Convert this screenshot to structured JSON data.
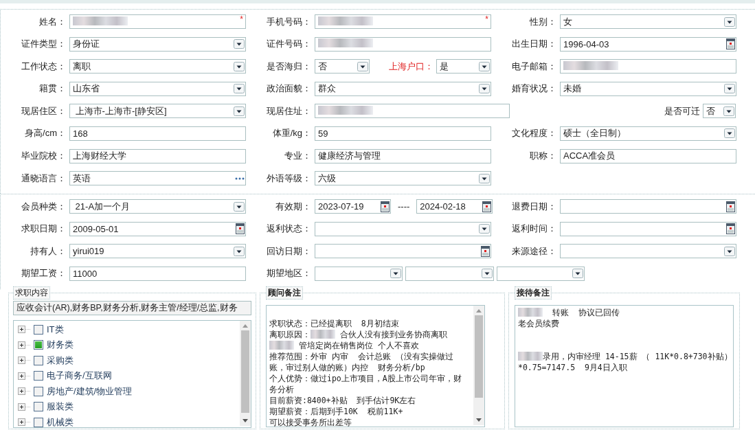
{
  "sections": [
    {
      "rows": [
        [
          {
            "label": "姓名：",
            "controls": [
              {
                "kind": "text",
                "redacted": true,
                "required_mark": "*"
              }
            ]
          },
          {
            "label": "手机号码：",
            "controls": [
              {
                "kind": "text",
                "redacted": true,
                "required_mark": "*"
              }
            ]
          },
          {
            "label": "性别：",
            "controls": [
              {
                "kind": "select",
                "value": "女"
              }
            ]
          }
        ],
        [
          {
            "label": "证件类型：",
            "controls": [
              {
                "kind": "select",
                "value": "身份证"
              }
            ]
          },
          {
            "label": "证件号码：",
            "controls": [
              {
                "kind": "text",
                "redacted": true
              }
            ]
          },
          {
            "label": "出生日期：",
            "controls": [
              {
                "kind": "date",
                "value": "1996-04-03"
              }
            ]
          }
        ],
        [
          {
            "label": "工作状态：",
            "controls": [
              {
                "kind": "select",
                "value": "离职"
              }
            ]
          },
          {
            "label": "是否海归：",
            "controls": [
              {
                "kind": "select",
                "value": "否"
              },
              {
                "kind": "label",
                "text": "上海户口：",
                "alert": true
              },
              {
                "kind": "select",
                "value": "是"
              }
            ]
          },
          {
            "label": "电子邮箱：",
            "controls": [
              {
                "kind": "text",
                "redacted": true
              }
            ]
          }
        ],
        [
          {
            "label": "籍贯：",
            "controls": [
              {
                "kind": "select",
                "value": "山东省"
              }
            ]
          },
          {
            "label": "政治面貌：",
            "controls": [
              {
                "kind": "select",
                "value": "群众"
              }
            ]
          },
          {
            "label": "婚育状况：",
            "controls": [
              {
                "kind": "select",
                "value": "未婚"
              }
            ]
          }
        ],
        [
          {
            "label": "现居住区：",
            "controls": [
              {
                "kind": "select",
                "value": " 上海市-上海市-[静安区]"
              }
            ]
          },
          {
            "label": "现居住址：",
            "controls": [
              {
                "kind": "text",
                "redacted": true
              },
              {
                "kind": "label",
                "text": "是否可迁",
                "alert": false
              },
              {
                "kind": "select",
                "value": "否"
              }
            ]
          }
        ],
        [
          {
            "label": "身高/cm：",
            "controls": [
              {
                "kind": "text",
                "value": "168"
              }
            ]
          },
          {
            "label": "体重/kg：",
            "controls": [
              {
                "kind": "text",
                "value": "59"
              }
            ]
          },
          {
            "label": "文化程度：",
            "controls": [
              {
                "kind": "select",
                "value": "硕士（全日制）"
              }
            ]
          }
        ],
        [
          {
            "label": "毕业院校：",
            "controls": [
              {
                "kind": "text",
                "value": "上海财经大学"
              }
            ]
          },
          {
            "label": "专业：",
            "controls": [
              {
                "kind": "text",
                "value": "健康经济与管理"
              }
            ]
          },
          {
            "label": "职称：",
            "controls": [
              {
                "kind": "text",
                "value": "ACCA准会员"
              }
            ]
          }
        ],
        [
          {
            "label": "通晓语言：",
            "controls": [
              {
                "kind": "lookup",
                "value": "英语"
              }
            ]
          },
          {
            "label": "外语等级：",
            "controls": [
              {
                "kind": "select",
                "value": "六级"
              }
            ]
          }
        ]
      ]
    },
    {
      "rows": [
        [
          {
            "label": "会员种类：",
            "controls": [
              {
                "kind": "select",
                "value": " 21-A加一个月"
              }
            ]
          },
          {
            "label": "有效期：",
            "controls": [
              {
                "kind": "date",
                "value": "2023-07-19"
              },
              {
                "kind": "label",
                "text": "----",
                "alert": false
              },
              {
                "kind": "date",
                "value": "2024-02-18"
              }
            ]
          },
          {
            "label": "退费日期：",
            "controls": [
              {
                "kind": "date"
              }
            ]
          }
        ],
        [
          {
            "label": "求职日期：",
            "controls": [
              {
                "kind": "date",
                "value": "2009-05-01"
              }
            ]
          },
          {
            "label": "返利状态：",
            "controls": [
              {
                "kind": "select"
              }
            ]
          },
          {
            "label": "返利时间：",
            "controls": [
              {
                "kind": "date"
              }
            ]
          }
        ],
        [
          {
            "label": "持有人：",
            "controls": [
              {
                "kind": "select",
                "value": "yirui019"
              }
            ]
          },
          {
            "label": "回访日期：",
            "controls": [
              {
                "kind": "date"
              }
            ]
          },
          {
            "label": "来源途径：",
            "controls": [
              {
                "kind": "select"
              }
            ]
          }
        ],
        [
          {
            "label": "期望工资：",
            "controls": [
              {
                "kind": "text",
                "value": "11000"
              }
            ]
          },
          {
            "label": "期望地区：",
            "controls": [
              {
                "kind": "select"
              },
              {
                "kind": "select"
              },
              {
                "kind": "select"
              }
            ]
          }
        ]
      ]
    }
  ],
  "job_panel": {
    "legend": "求职内容",
    "selected_jobs": "应收会计(AR),财务BP,财务分析,财务主管/经理/总监,财务",
    "tree": [
      {
        "label": "IT类",
        "checked": false
      },
      {
        "label": "财务类",
        "checked": true
      },
      {
        "label": "采购类",
        "checked": false
      },
      {
        "label": "电子商务/互联网",
        "checked": false
      },
      {
        "label": "房地产/建筑/物业管理",
        "checked": false
      },
      {
        "label": "服装类",
        "checked": false
      },
      {
        "label": "机械类",
        "checked": false
      }
    ]
  },
  "note_panels": [
    {
      "legend": "顾问备注",
      "scrollbar": true,
      "lines": [
        [
          {
            "kind": "blank"
          }
        ],
        [
          {
            "text": "求职状态：已经提离职  8月初结束"
          }
        ],
        [
          {
            "text": "离职原因："
          },
          {
            "redacted": true
          },
          {
            "text": " 合伙人没有接到业务协商离职"
          }
        ],
        [
          {
            "redacted": true
          },
          {
            "text": " 管培定岗在销售岗位 个人不喜欢"
          }
        ],
        [
          {
            "text": "推荐范围：外审 内审  会计总账 （没有实操做过"
          }
        ],
        [
          {
            "text": "账，审过别人做的账）内控  财务分析/bp"
          }
        ],
        [
          {
            "text": "个人优势：做过ipo上市项目，A股上市公司年审，财"
          }
        ],
        [
          {
            "text": "务分析"
          }
        ],
        [
          {
            "text": "目前薪资:8400+补贴  到手估计9K左右"
          }
        ],
        [
          {
            "text": "期望薪资：后期到手10K  税前11K+"
          }
        ],
        [
          {
            "text": "可以接受事务所出差等"
          }
        ]
      ]
    },
    {
      "legend": "接待备注",
      "scrollbar": false,
      "lines": [
        [
          {
            "redacted": true
          },
          {
            "text": "  转账  协议已回传"
          }
        ],
        [
          {
            "text": "老会员续费"
          }
        ],
        [
          {
            "kind": "blank"
          }
        ],
        [
          {
            "kind": "blank"
          }
        ],
        [
          {
            "redacted": true
          },
          {
            "text": "录用，内审经理 14-15薪 （ 11K*0.8+730补贴）"
          }
        ],
        [
          {
            "text": "*0.75=7147.5  9月4日入职"
          }
        ]
      ]
    }
  ]
}
